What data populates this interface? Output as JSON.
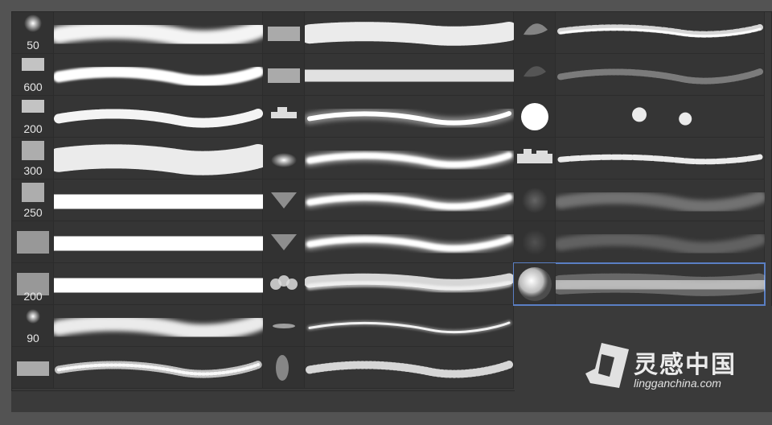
{
  "brush_panel": {
    "columns": [
      {
        "brushes": [
          {
            "size": "50",
            "thumb": "soft-dot",
            "stroke": "soft-thick"
          },
          {
            "size": "600",
            "thumb": "rough-rect",
            "stroke": "medium-solid"
          },
          {
            "size": "200",
            "thumb": "rough-rect",
            "stroke": "rough-thin"
          },
          {
            "size": "300",
            "thumb": "textured-square",
            "stroke": "textured-wide"
          },
          {
            "size": "250",
            "thumb": "textured-square",
            "stroke": "solid-wide"
          },
          {
            "size": "",
            "thumb": "speckle-rect",
            "stroke": "solid-wide"
          },
          {
            "size": "200",
            "thumb": "speckle-rect",
            "stroke": "solid-wide"
          },
          {
            "size": "90",
            "thumb": "soft-dot-small",
            "stroke": "soft-medium"
          },
          {
            "size": "",
            "thumb": "bristle-rect",
            "stroke": "splatter-thin"
          }
        ]
      },
      {
        "brushes": [
          {
            "size": "",
            "thumb": "bristle-rect",
            "stroke": "bristle-wide"
          },
          {
            "size": "",
            "thumb": "bristle-rect",
            "stroke": "bristle-wide-soft"
          },
          {
            "size": "",
            "thumb": "blocks",
            "stroke": "thin-soft-glow"
          },
          {
            "size": "",
            "thumb": "soft-blob",
            "stroke": "thin-glow"
          },
          {
            "size": "",
            "thumb": "triangle-soft",
            "stroke": "thin-glow"
          },
          {
            "size": "",
            "thumb": "triangle-soft",
            "stroke": "thin-glow"
          },
          {
            "size": "",
            "thumb": "bubbles",
            "stroke": "bubbles"
          },
          {
            "size": "",
            "thumb": "thin-dash",
            "stroke": "hairline"
          },
          {
            "size": "",
            "thumb": "leaf",
            "stroke": "grass"
          }
        ]
      },
      {
        "brushes": [
          {
            "size": "",
            "thumb": "feather",
            "stroke": "cloud-line"
          },
          {
            "size": "",
            "thumb": "feather-faint",
            "stroke": "faint-chain"
          },
          {
            "size": "",
            "thumb": "hard-circle",
            "stroke": "scatter-dots"
          },
          {
            "size": "",
            "thumb": "city-blocks",
            "stroke": "blocks-line"
          },
          {
            "size": "",
            "thumb": "faint-noise",
            "stroke": "faint-band"
          },
          {
            "size": "",
            "thumb": "fainter-noise",
            "stroke": "faint-band-2"
          },
          {
            "size": "",
            "thumb": "soft-sphere",
            "stroke": "spray",
            "selected": true
          }
        ]
      }
    ]
  },
  "watermark": {
    "title": "灵感中国",
    "url": "lingganchina.com"
  },
  "colors": {
    "window_bg": "#535353",
    "panel_bg": "#3a3a3a",
    "cell_bg": "#353535",
    "selection": "#5a7fc4",
    "stroke": "#ffffff"
  }
}
